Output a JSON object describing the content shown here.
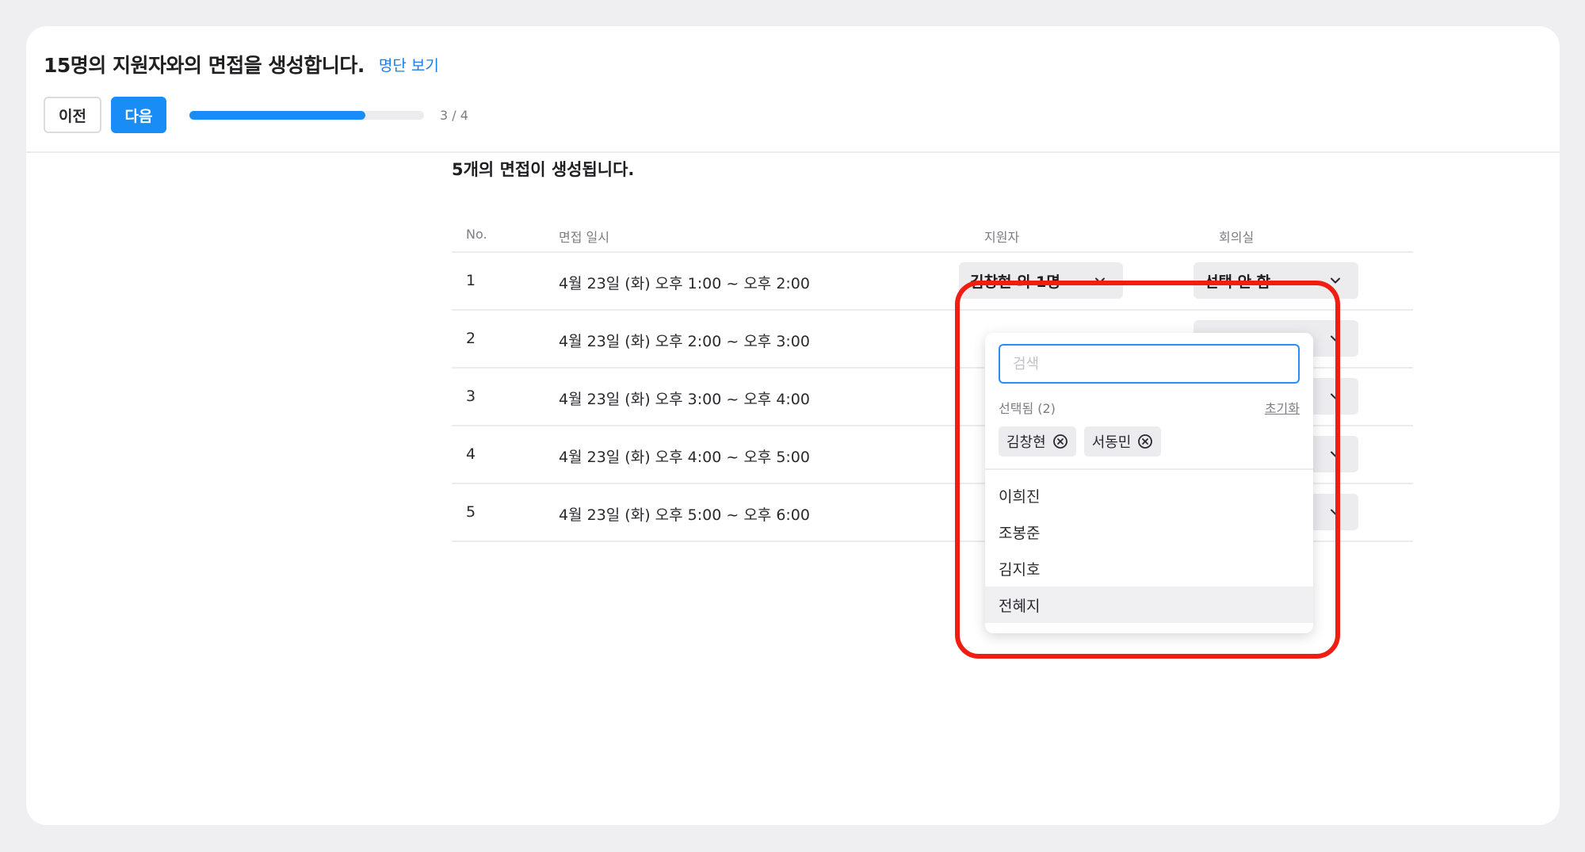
{
  "header": {
    "title": "15명의 지원자와의 면접을 생성합니다.",
    "list_link": "명단 보기",
    "prev_label": "이전",
    "next_label": "다음",
    "progress_text": "3 / 4",
    "progress_fraction": 0.75
  },
  "content": {
    "title": "5개의 면접이 생성됩니다."
  },
  "table": {
    "columns": {
      "no": "No.",
      "datetime": "면접 일시",
      "applicant": "지원자",
      "room": "회의실"
    },
    "rows": [
      {
        "no": "1",
        "datetime": "4월 23일 (화) 오후 1:00 ~ 오후 2:00",
        "applicant": "김창현 외 1명",
        "room": "선택 안 함"
      },
      {
        "no": "2",
        "datetime": "4월 23일 (화) 오후 2:00 ~ 오후 3:00"
      },
      {
        "no": "3",
        "datetime": "4월 23일 (화) 오후 3:00 ~ 오후 4:00"
      },
      {
        "no": "4",
        "datetime": "4월 23일 (화) 오후 4:00 ~ 오후 5:00"
      },
      {
        "no": "5",
        "datetime": "4월 23일 (화) 오후 5:00 ~ 오후 6:00"
      }
    ]
  },
  "dropdown": {
    "search_placeholder": "검색",
    "selected_label": "선택됨 (2)",
    "reset_label": "초기화",
    "selected": [
      "김창현",
      "서동민"
    ],
    "options": [
      "이희진",
      "조봉준",
      "김지호",
      "전혜지"
    ]
  },
  "colors": {
    "accent": "#1a8cf5",
    "highlight": "#f01e12"
  }
}
